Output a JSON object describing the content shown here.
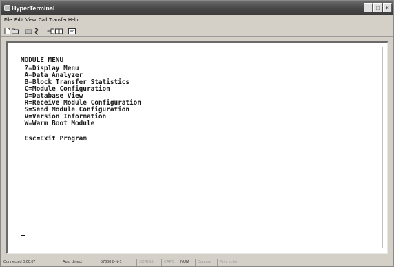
{
  "window": {
    "title": "HyperTerminal"
  },
  "menubar": {
    "items": [
      "File",
      "Edit",
      "View",
      "Call",
      "Transfer",
      "Help"
    ]
  },
  "toolbar": {
    "icons": [
      "new-icon",
      "open-icon",
      "phone-icon",
      "disconnect-icon",
      "send-icon",
      "receive-icon",
      "properties-icon"
    ]
  },
  "terminal": {
    "lines": [
      "MODULE MENU",
      " ?=Display Menu",
      " A=Data Analyzer",
      " B=Block Transfer Statistics",
      " C=Module Configuration",
      " D=Database View",
      " R=Receive Module Configuration",
      " S=Send Module Configuration",
      " V=Version Information",
      " W=Warm Boot Module",
      "",
      " Esc=Exit Program"
    ]
  },
  "statusbar": {
    "connected": "Connected 0:00:07",
    "detect": "Auto detect",
    "settings": "57600 8-N-1",
    "scroll": "SCROLL",
    "caps": "CAPS",
    "num": "NUM",
    "capture": "Capture",
    "print_echo": "Print echo"
  }
}
